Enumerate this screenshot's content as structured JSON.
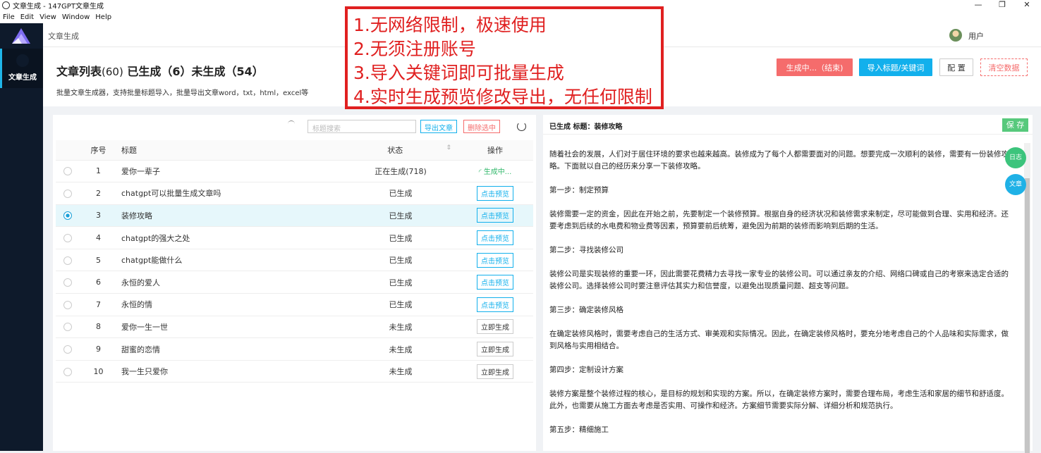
{
  "window": {
    "title": "文章生成 - 147GPT文章生成"
  },
  "menu": [
    "File",
    "Edit",
    "View",
    "Window",
    "Help"
  ],
  "sidebar": {
    "nav_label": "文章生成"
  },
  "topbar": {
    "breadcrumb": "文章生成",
    "user": "用户"
  },
  "header": {
    "title_a": "文章列表",
    "title_a_count": "(60)",
    "title_b": "已生成（6）未生成（54）",
    "subtitle": "批量文章生成器，支持批量标题导入，批量导出文章word，txt，html，excel等",
    "buttons": {
      "generating": "生成中...（结束)",
      "import": "导入标题/关键词",
      "config": "配 置",
      "clear": "清空数据"
    }
  },
  "overlay": [
    "1.无网络限制，极速使用",
    "2.无须注册账号",
    "3.导入关键词即可批量生成",
    "4.实时生成预览修改导出，无任何限制"
  ],
  "list": {
    "search_placeholder": "标题搜索",
    "export_label": "导出文章",
    "delete_label": "删除选中",
    "columns": {
      "index": "序号",
      "title": "标题",
      "status": "状态",
      "action": "操作"
    },
    "rows": [
      {
        "index": "1",
        "title": "爱你一辈子",
        "status": "正在生成(718)",
        "state": "ing",
        "action": "生成中..."
      },
      {
        "index": "2",
        "title": "chatgpt可以批量生成文章吗",
        "status": "已生成",
        "state": "gen",
        "action": "点击预览"
      },
      {
        "index": "3",
        "title": "装修攻略",
        "status": "已生成",
        "state": "gen",
        "action": "点击预览",
        "selected": true
      },
      {
        "index": "4",
        "title": "chatgpt的强大之处",
        "status": "已生成",
        "state": "gen",
        "action": "点击预览"
      },
      {
        "index": "5",
        "title": "chatgpt能做什么",
        "status": "已生成",
        "state": "gen",
        "action": "点击预览"
      },
      {
        "index": "6",
        "title": "永恒的爱人",
        "status": "已生成",
        "state": "gen",
        "action": "点击预览"
      },
      {
        "index": "7",
        "title": "永恒的情",
        "status": "已生成",
        "state": "gen",
        "action": "点击预览"
      },
      {
        "index": "8",
        "title": "爱你一生一世",
        "status": "未生成",
        "state": "none",
        "action": "立即生成"
      },
      {
        "index": "9",
        "title": "甜蜜的恋情",
        "status": "未生成",
        "state": "none",
        "action": "立即生成"
      },
      {
        "index": "10",
        "title": "我一生只爱你",
        "status": "未生成",
        "state": "none",
        "action": "立即生成"
      }
    ]
  },
  "preview": {
    "header": "已生成 标题：装修攻略",
    "save_label": "保 存",
    "float_log": "日志",
    "float_article": "文章",
    "paragraphs": [
      "随着社会的发展，人们对于居住环境的要求也越来越高。装修成为了每个人都需要面对的问题。想要完成一次顺利的装修，需要有一份装修攻略。下面就以自己的经历来分享一下装修攻略。",
      "第一步：制定预算",
      "装修需要一定的资金，因此在开始之前，先要制定一个装修预算。根据自身的经济状况和装修需求来制定，尽可能做到合理、实用和经济。还要考虑到后续的水电费和物业费等因素，预算要前后统筹，避免因为前期的装修而影响到后期的生活。",
      "第二步：寻找装修公司",
      "装修公司是实现装修的重要一环，因此需要花费精力去寻找一家专业的装修公司。可以通过亲友的介绍、网络口碑或自己的考察来选定合适的装修公司。选择装修公司时要注意评估其实力和信誉度，以避免出现质量问题、超支等问题。",
      "第三步：确定装修风格",
      "在确定装修风格时，需要考虑自己的生活方式、审美观和实际情况。因此，在确定装修风格时，要充分地考虑自己的个人品味和实际需求，做到风格与实用相结合。",
      "第四步：定制设计方案",
      "装修方案是整个装修过程的核心，是目标的规划和实现的方案。所以，在确定装修方案时，需要合理布局，考虑生活和家居的细节和舒适度。此外，也需要从施工方面去考虑是否实用、可操作和经济。方案细节需要实际分解、详细分析和规范执行。",
      "第五步：精细施工"
    ]
  }
}
